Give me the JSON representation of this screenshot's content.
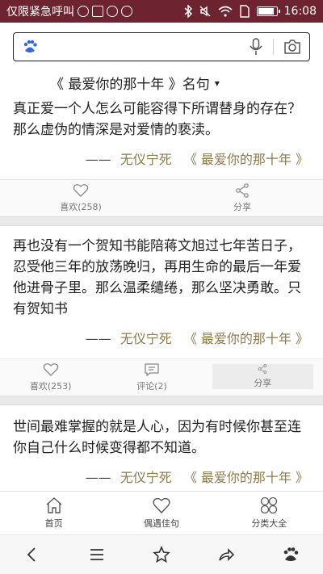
{
  "status_bar": {
    "carrier": "仅限紧急呼叫",
    "time": "16:08",
    "battery_level": 0.9
  },
  "search": {
    "placeholder": ""
  },
  "page": {
    "title": "《 最爱你的那十年 》名句",
    "caret": "▾"
  },
  "quotes": [
    {
      "text": "真正爱一个人怎么可能容得下所谓替身的存在？那么虚伪的情深是对爱情的亵渎。",
      "dash": "——",
      "author": "无仪宁死",
      "book": "《 最爱你的那十年 》",
      "like_label": "喜欢(258)",
      "share_label": "分享"
    },
    {
      "text": "再也没有一个贺知书能陪蒋文旭过七年苦日子，忍受他三年的放荡晚归，再用生命的最后一年爱他进骨子里。那么温柔缱绻，那么坚决勇敢。只有贺知书",
      "dash": "——",
      "author": "无仪宁死",
      "book": "《 最爱你的那十年 》",
      "like_label": "喜欢(253)",
      "comment_label": "评论(2)",
      "share_label": "分享"
    },
    {
      "text": "世间最难掌握的就是人心，因为有时候你甚至连你自己什么时候变得都不知道。",
      "dash": "——",
      "author": "无仪宁死",
      "book": "《 最爱你的那十年 》"
    }
  ],
  "tabbar": {
    "home": "首页",
    "random": "偶遇佳句",
    "categories": "分类大全"
  },
  "colors": {
    "status_bar": "#6e2330",
    "source_text": "#8c7a4c",
    "baidu_blue": "#2f67e2"
  }
}
